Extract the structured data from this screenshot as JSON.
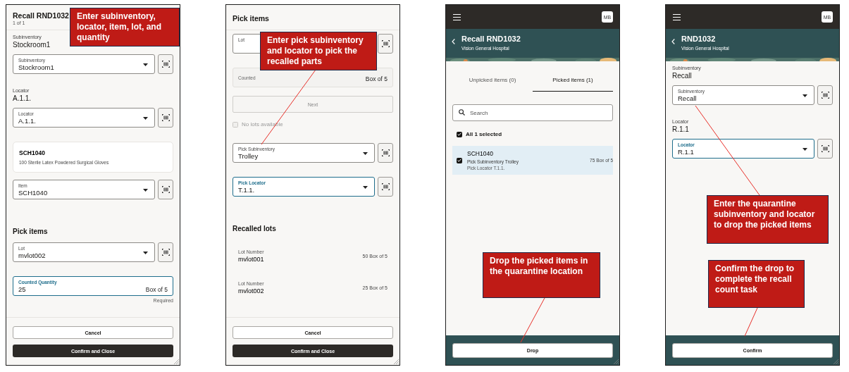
{
  "panels": [
    {
      "header": {
        "kind": "plain",
        "title": "Recall RND1032",
        "subtitle": "1 of 1"
      },
      "rows": [
        {
          "kind": "readout",
          "label": "Subinventory",
          "value": "Stockroom1"
        },
        {
          "kind": "select",
          "label": "Subinventory",
          "value": "Stockroom1",
          "focused": false
        },
        {
          "kind": "readout",
          "label": "Locator",
          "value": "A.1.1."
        },
        {
          "kind": "select",
          "label": "Locator",
          "value": "A.1.1.",
          "focused": false
        },
        {
          "kind": "card",
          "title": "SCH1040",
          "text": "100 Sterile Latex Powdered Surgical Gloves"
        },
        {
          "kind": "select",
          "label": "Item",
          "value": "SCH1040",
          "focused": false
        },
        {
          "kind": "heading",
          "text": "Pick items"
        },
        {
          "kind": "select",
          "label": "Lot",
          "value": "mvlot002",
          "focused": false
        },
        {
          "kind": "quantity",
          "label": "Counted Quantity",
          "value": "25",
          "unit": "Box of 5",
          "hint": "Required",
          "focused": true,
          "disabled": false
        }
      ],
      "footer": {
        "kind": "light",
        "buttons": [
          {
            "label": "Cancel",
            "primary": false
          },
          {
            "label": "Confirm and Close",
            "primary": true
          }
        ]
      },
      "callouts": [
        {
          "text": "Enter subinventory, locator, item, lot, and quantity"
        }
      ]
    },
    {
      "header": {
        "kind": "plain",
        "title": "Pick items"
      },
      "rows": [
        {
          "kind": "select",
          "label": "Lot",
          "focused": false
        },
        {
          "kind": "quantity",
          "label": "Counted",
          "unit": "Box of 5",
          "focused": false,
          "disabled": true
        },
        {
          "kind": "button",
          "label": "Next",
          "disabled": true
        },
        {
          "kind": "checkbox",
          "label": "No lots available",
          "checked": false,
          "disabled": true
        },
        {
          "kind": "select",
          "label": "Pick Subinventory",
          "value": "Trolley",
          "focused": false
        },
        {
          "kind": "select",
          "label": "Pick Locator",
          "value": "T.1.1.",
          "focused": true
        },
        {
          "kind": "heading",
          "text": "Recalled lots"
        },
        {
          "kind": "lot-row",
          "label": "Lot Number",
          "value": "mvlot001",
          "quantity": "50 Box of 5"
        },
        {
          "kind": "lot-row",
          "label": "Lot Number",
          "value": "mvlot002",
          "quantity": "25 Box of 5"
        }
      ],
      "footer": {
        "kind": "light",
        "buttons": [
          {
            "label": "Cancel",
            "primary": false
          },
          {
            "label": "Confirm and Close",
            "primary": true
          }
        ]
      },
      "callouts": [
        {
          "text": "Enter pick subinventory and locator to pick the recalled parts"
        }
      ]
    },
    {
      "header": {
        "kind": "banner",
        "avatar": "MB",
        "title": "Recall RND1032",
        "subtitle": "Vision General Hospital"
      },
      "rows": [
        {
          "kind": "tabs",
          "tabs": [
            {
              "label": "Unpicked items (0)",
              "selected": false
            },
            {
              "label": "Picked items (1)",
              "selected": true
            }
          ]
        },
        {
          "kind": "search",
          "placeholder": "Search"
        },
        {
          "kind": "select-all",
          "label": "All 1 selected",
          "checked": true
        },
        {
          "kind": "picked-row",
          "checked": true,
          "title": "SCH1040",
          "line_1": "Pick Subinventory Trolley",
          "line_2": "Pick Locator T.1.1.",
          "quantity": "75 Box of 5"
        }
      ],
      "footer": {
        "kind": "dark",
        "buttons": [
          {
            "label": "Drop",
            "primary": false
          }
        ]
      },
      "callouts": [
        {
          "text": "Drop the picked items in the quarantine location"
        }
      ]
    },
    {
      "header": {
        "kind": "banner",
        "avatar": "MB",
        "title": "RND1032",
        "subtitle": "Vision General Hospital"
      },
      "rows": [
        {
          "kind": "readout",
          "label": "Subinventory",
          "value": "Recall"
        },
        {
          "kind": "select",
          "label": "Subinventory",
          "value": "Recall",
          "focused": false
        },
        {
          "kind": "readout",
          "label": "Locator",
          "value": "R.1.1"
        },
        {
          "kind": "select",
          "label": "Locator",
          "value": "R.1.1",
          "focused": true
        }
      ],
      "footer": {
        "kind": "dark",
        "buttons": [
          {
            "label": "Confirm",
            "primary": false
          }
        ]
      },
      "callouts": [
        {
          "text": "Enter the quarantine subinventory and locator to drop the picked items"
        },
        {
          "text": "Confirm the drop to complete the recall count task"
        }
      ]
    }
  ]
}
